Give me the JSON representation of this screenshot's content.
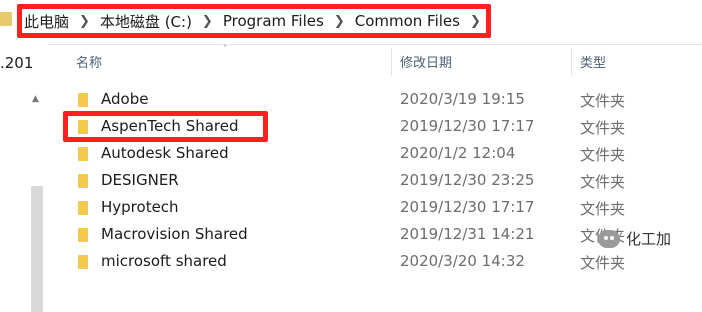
{
  "breadcrumb": {
    "items": [
      "此电脑",
      "本地磁盘 (C:)",
      "Program Files",
      "Common Files"
    ]
  },
  "left_pane": {
    "partial_text": ".201"
  },
  "columns": {
    "name": "名称",
    "date": "修改日期",
    "type": "类型"
  },
  "rows": [
    {
      "name": "Adobe",
      "date": "2020/3/19 19:15",
      "type": "文件夹"
    },
    {
      "name": "AspenTech Shared",
      "date": "2019/12/30 17:17",
      "type": "文件夹"
    },
    {
      "name": "Autodesk Shared",
      "date": "2020/1/2 12:04",
      "type": "文件夹"
    },
    {
      "name": "DESIGNER",
      "date": "2019/12/30 23:25",
      "type": "文件夹"
    },
    {
      "name": "Hyprotech",
      "date": "2019/12/30 17:17",
      "type": "文件夹"
    },
    {
      "name": "Macrovision Shared",
      "date": "2019/12/31 14:21",
      "type": "文件夹"
    },
    {
      "name": "microsoft shared",
      "date": "2020/3/20 14:32",
      "type": "文件夹"
    }
  ],
  "watermark": {
    "text": "化工加"
  },
  "colors": {
    "highlight_box": "#ff1f1f",
    "folder": "#f2c94c",
    "header_text": "#4c607a"
  }
}
